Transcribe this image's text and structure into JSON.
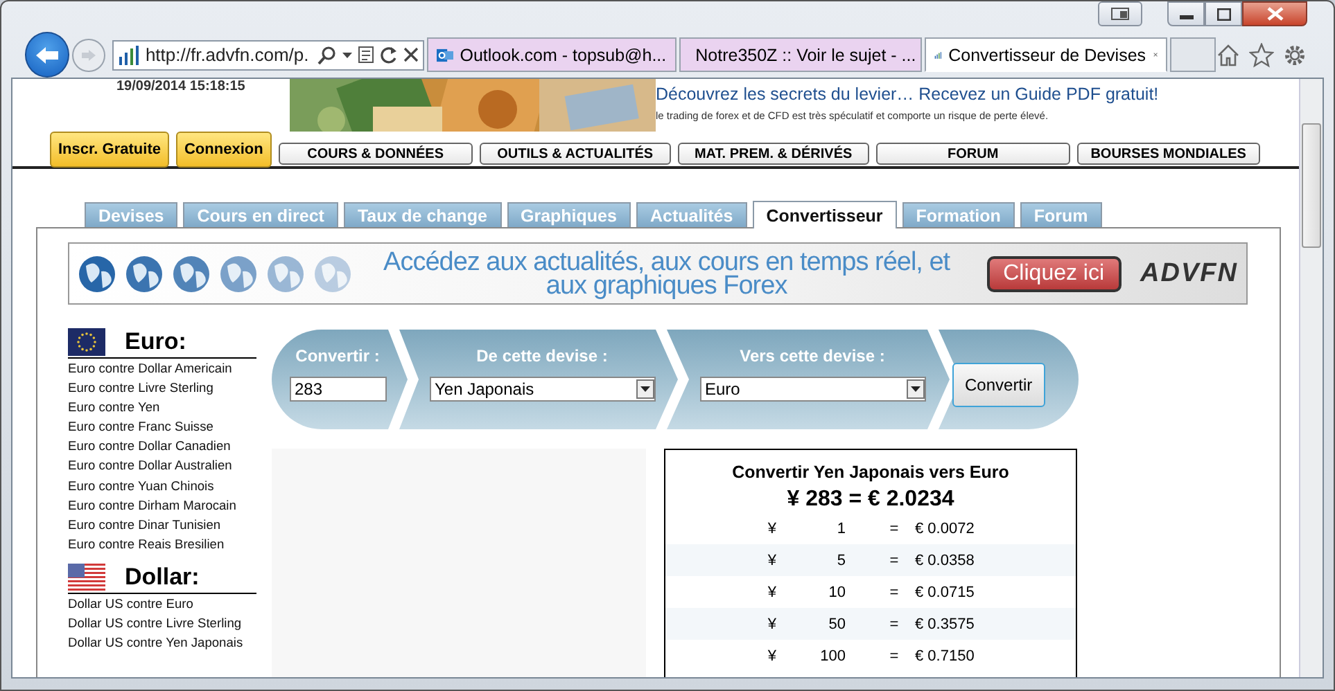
{
  "browser": {
    "address": "http://fr.advfn.com/p.",
    "tabs": [
      {
        "label": "Outlook.com - topsub@h...",
        "selected": false,
        "kind": "mail"
      },
      {
        "label": "Notre350Z :: Voir le sujet - ...",
        "selected": false,
        "kind": "disc"
      },
      {
        "label": "Convertisseur de Devises",
        "selected": true,
        "kind": "bars"
      }
    ]
  },
  "header": {
    "date": "19/09/2014 15:18:15",
    "ad_headline": "Découvrez les secrets du levier… Recevez un Guide PDF gratuit!",
    "ad_disclaimer": "le trading de forex et de CFD est très spéculatif et comporte un risque de perte élevé.",
    "account_buttons": [
      "Inscr. Gratuite",
      "Connexion"
    ],
    "nav": [
      "COURS & DONNÉES",
      "OUTILS & ACTUALITÉS",
      "MAT. PREM. & DÉRIVÉS",
      "FORUM",
      "BOURSES MONDIALES"
    ]
  },
  "tabs": [
    {
      "label": "Devises",
      "selected": false
    },
    {
      "label": "Cours en direct",
      "selected": false
    },
    {
      "label": "Taux de change",
      "selected": false
    },
    {
      "label": "Graphiques",
      "selected": false
    },
    {
      "label": "Actualités",
      "selected": false
    },
    {
      "label": "Convertisseur",
      "selected": true
    },
    {
      "label": "Formation",
      "selected": false
    },
    {
      "label": "Forum",
      "selected": false
    }
  ],
  "banner": {
    "text": "Accédez aux actualités, aux cours en temps réel, et aux graphiques Forex",
    "button": "Cliquez ici",
    "logo": "ADVFN"
  },
  "sidebar": [
    {
      "title": "Euro:",
      "kind": "eu",
      "links": [
        "Euro contre Dollar Americain",
        "Euro contre Livre Sterling",
        "Euro contre Yen",
        "Euro contre Franc Suisse",
        "Euro contre Dollar Canadien",
        "Euro contre Dollar Australien",
        "Euro contre Yuan Chinois",
        "Euro contre Dirham Marocain",
        "Euro contre Dinar Tunisien",
        "Euro contre Reais Bresilien"
      ]
    },
    {
      "title": "Dollar:",
      "kind": "us",
      "links": [
        "Dollar US contre Euro",
        "Dollar US contre Livre Sterling",
        "Dollar US contre Yen Japonais"
      ]
    }
  ],
  "converter": {
    "amount_label": "Convertir :",
    "amount": "283",
    "from_label": "De cette devise :",
    "from": "Yen Japonais",
    "to_label": "Vers cette devise :",
    "to": "Euro",
    "button": "Convertir"
  },
  "result": {
    "title": "Convertir Yen Japonais vers Euro",
    "summary": "¥ 283 = € 2.0234",
    "rows": [
      {
        "symbol": "¥",
        "amount": "1",
        "equals": "=",
        "value": "€ 0.0072"
      },
      {
        "symbol": "¥",
        "amount": "5",
        "equals": "=",
        "value": "€ 0.0358"
      },
      {
        "symbol": "¥",
        "amount": "10",
        "equals": "=",
        "value": "€ 0.0715"
      },
      {
        "symbol": "¥",
        "amount": "50",
        "equals": "=",
        "value": "€ 0.3575"
      },
      {
        "symbol": "¥",
        "amount": "100",
        "equals": "=",
        "value": "€ 0.7150"
      }
    ]
  }
}
